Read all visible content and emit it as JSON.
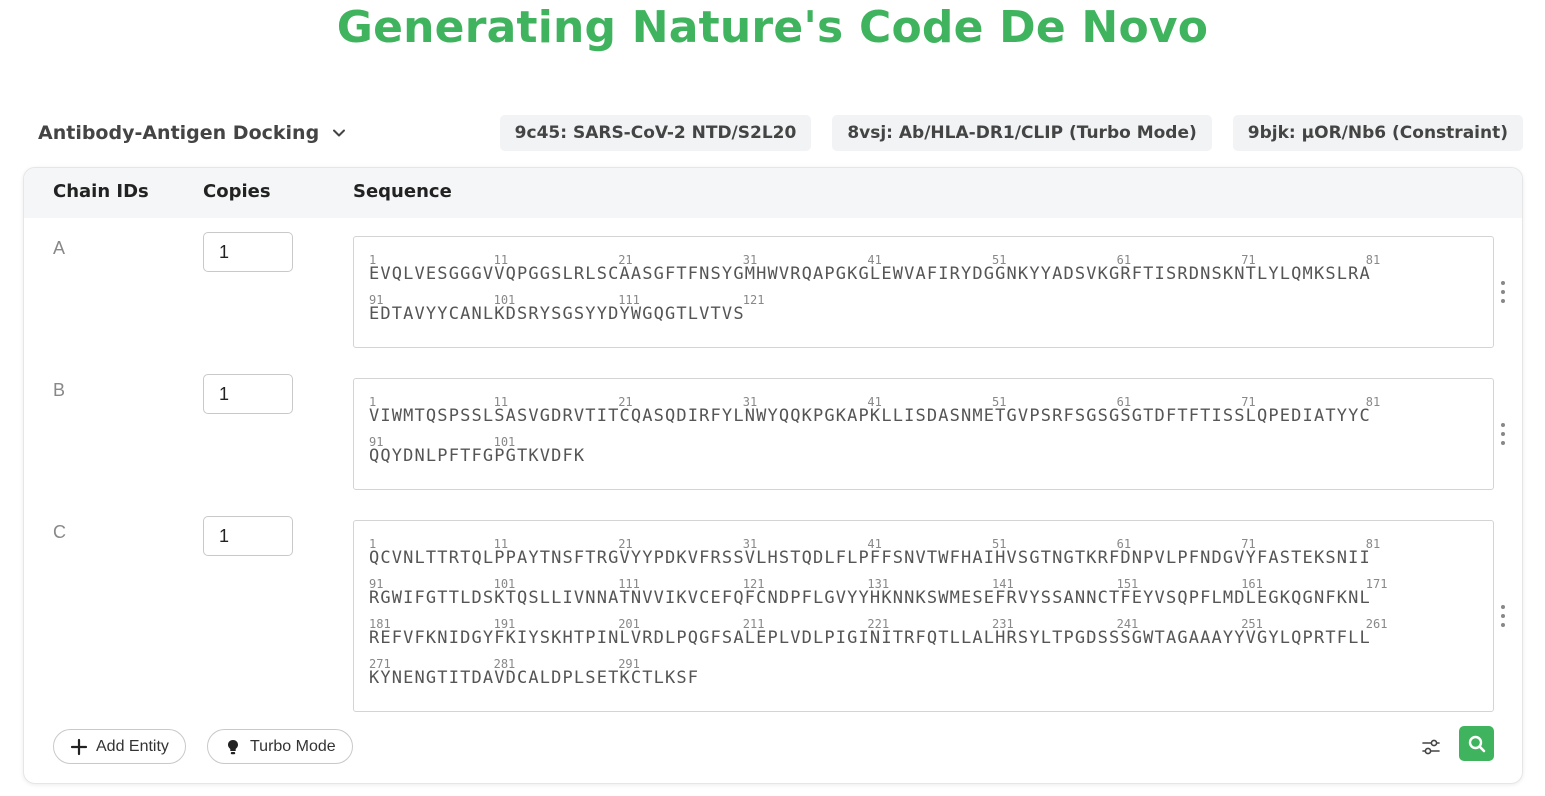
{
  "title": "Generating Nature's Code De Novo",
  "mode": {
    "label": "Antibody-Antigen Docking"
  },
  "examples": [
    "9c45: SARS-CoV-2 NTD/S2L20",
    "8vsj: Ab/HLA-DR1/CLIP (Turbo Mode)",
    "9bjk: μOR/Nb6 (Constraint)"
  ],
  "table": {
    "headers": {
      "chain_ids": "Chain IDs",
      "copies": "Copies",
      "sequence": "Sequence"
    },
    "rows": [
      {
        "chain": "A",
        "copies": "1",
        "lines": [
          {
            "text": "EVQLVESGGGVVQPGGSLRLSCAASGFTFNSYGMHWVRQAPGKGLEWVAFIRYDGGNKYYADSVKGRFTISRDNSKNTLYLQMKSLRA",
            "start": 1
          },
          {
            "text": "EDTAVYYCANLKDSRYSGSYYDYWGQGTLVTVS",
            "start": 91
          }
        ]
      },
      {
        "chain": "B",
        "copies": "1",
        "lines": [
          {
            "text": "VIWMTQSPSSLSASVGDRVTITCQASQDIRFYLNWYQQKPGKAPKLLISDASNMETGVPSRFSGSGSGTDFTFTISSLQPEDIATYYC",
            "start": 1
          },
          {
            "text": "QQYDNLPFTFGPGTKVDFK",
            "start": 91
          }
        ]
      },
      {
        "chain": "C",
        "copies": "1",
        "lines": [
          {
            "text": "QCVNLTTRTQLPPAYTNSFTRGVYYPDKVFRSSVLHSTQDLFLPFFSNVTWFHAIHVSGTNGTKRFDNPVLPFNDGVYFASTEKSNII",
            "start": 1
          },
          {
            "text": "RGWIFGTTLDSKTQSLLIVNNATNVVIKVCEFQFCNDPFLGVYYHKNNKSWMESEFRVYSSANNCTFEYVSQPFLMDLEGKQGNFKNL",
            "start": 91
          },
          {
            "text": "REFVFKNIDGYFKIYSKHTPINLVRDLPQGFSALEPLVDLPIGINITRFQTLLALHRSYLTPGDSSSGWTAGAAAYYVGYLQPRTFLL",
            "start": 181
          },
          {
            "text": "KYNENGTITDAVDCALDPLSETKCTLKSF",
            "start": 271
          }
        ]
      }
    ]
  },
  "buttons": {
    "add_entity": "Add Entity",
    "turbo_mode": "Turbo Mode"
  },
  "icons": {
    "mode_select": "chevron-down-icon",
    "add_entity": "plus-icon",
    "turbo_mode": "bulb-icon",
    "settings": "sliders-icon",
    "search": "search-icon",
    "row_menu": "more-vertical-icon"
  },
  "colors": {
    "accent": "#3fb35e",
    "header_bg": "#f5f6f7",
    "chip_bg": "#f1f3f4"
  }
}
